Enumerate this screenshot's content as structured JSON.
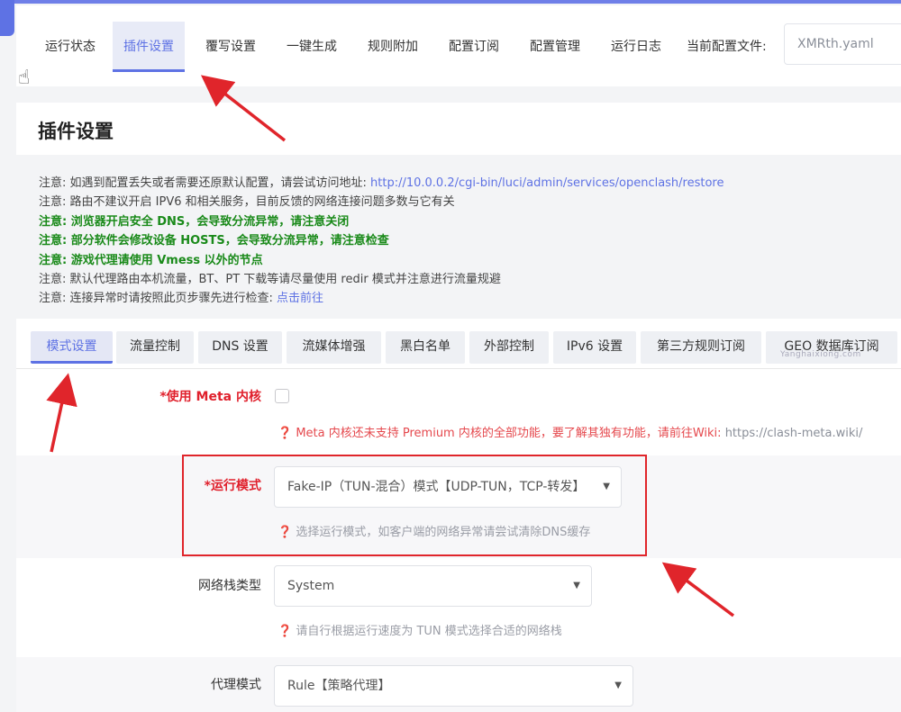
{
  "topnav": {
    "tabs": [
      {
        "label": "运行状态"
      },
      {
        "label": "插件设置"
      },
      {
        "label": "覆写设置"
      },
      {
        "label": "一键生成"
      },
      {
        "label": "规则附加"
      },
      {
        "label": "配置订阅"
      },
      {
        "label": "配置管理"
      },
      {
        "label": "运行日志"
      }
    ],
    "active_tab": "插件设置",
    "config_label": "当前配置文件:",
    "config_value": "XMRth.yaml"
  },
  "page_title": "插件设置",
  "notices": {
    "n1_text": "注意: 如遇到配置丢失或者需要还原默认配置，请尝试访问地址: ",
    "n1_link": "http://10.0.0.2/cgi-bin/luci/admin/services/openclash/restore",
    "n2": "注意: 路由不建议开启 IPV6 和相关服务，目前反馈的网络连接问题多数与它有关",
    "n3": "注意: 浏览器开启安全 DNS，会导致分流异常，请注意关闭",
    "n4": "注意: 部分软件会修改设备 HOSTS，会导致分流异常，请注意检查",
    "n5": "注意: 游戏代理请使用 Vmess 以外的节点",
    "n6": "注意: 默认代理路由本机流量，BT、PT 下载等请尽量使用 redir 模式并注意进行流量规避",
    "n7_text": "注意: 连接异常时请按照此页步骤先进行检查: ",
    "n7_link": "点击前往"
  },
  "subtabs": [
    {
      "label": "模式设置"
    },
    {
      "label": "流量控制"
    },
    {
      "label": "DNS 设置"
    },
    {
      "label": "流媒体增强"
    },
    {
      "label": "黑白名单"
    },
    {
      "label": "外部控制"
    },
    {
      "label": "IPv6 设置"
    },
    {
      "label": "第三方规则订阅"
    },
    {
      "label": "GEO 数据库订阅"
    }
  ],
  "watermark": "Yanghaixiong.com",
  "form": {
    "meta": {
      "label": "*使用 Meta 内核",
      "checked": false,
      "hint_icon": "❓",
      "hint": "Meta 内核还未支持 Premium 内核的全部功能，要了解其独有功能，请前往Wiki: ",
      "hint_link": "https://clash-meta.wiki/"
    },
    "run_mode": {
      "label": "*运行模式",
      "value": "Fake-IP（TUN-混合）模式【UDP-TUN，TCP-转发】",
      "hint": "选择运行模式，如客户端的网络异常请尝试清除DNS缓存"
    },
    "stack": {
      "label": "网络栈类型",
      "value": "System",
      "hint": "请自行根据运行速度为 TUN 模式选择合适的网络栈"
    },
    "proxy_mode": {
      "label": "代理模式",
      "value": "Rule【策略代理】"
    }
  },
  "colors": {
    "accent": "#5e72e4",
    "annotation_red": "#e0252b",
    "notice_green": "#1a8a1a"
  }
}
